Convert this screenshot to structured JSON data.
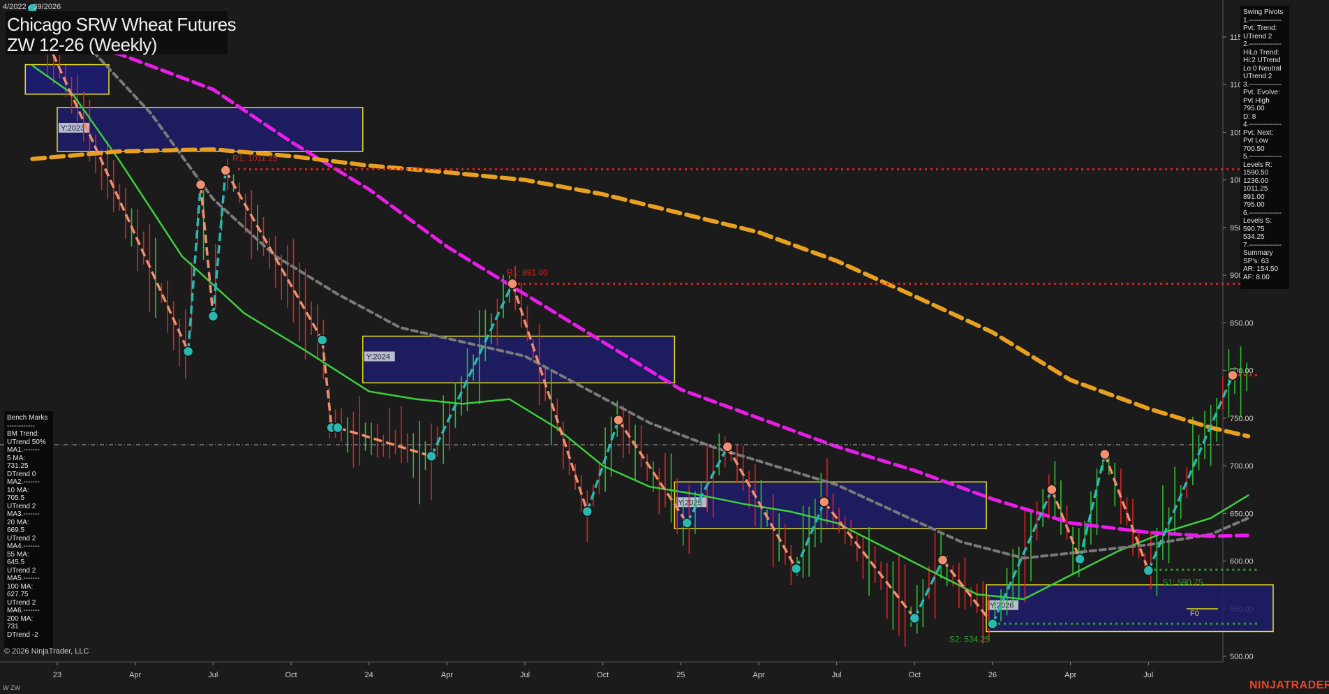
{
  "header": {
    "date_range": "4/2022 - 39/2026",
    "title": "Chicago SRW Wheat Futures",
    "subtitle": "ZW 12-26 (Weekly)"
  },
  "swing_pivots_panel": [
    "Swing Pivots",
    "1.--------------",
    "Pvt. Trend:",
    "UTrend 2",
    "2.--------------",
    "HiLo Trend:",
    "Hi:2 UTrend",
    "Lo:0 Neutral",
    "UTrend 2",
    "3.--------------",
    "Pvt. Evolve:",
    "Pvt High",
    "795.00",
    "D: 8",
    "4.--------------",
    "Pvt. Next:",
    "Pvt Low",
    "700.50",
    "5.--------------",
    "Levels R:",
    "1590.50",
    "1236.00",
    "1011.25",
    "891.00",
    "795.00",
    "6.--------------",
    "Levels S:",
    "590.75",
    "534.25",
    "7.--------------",
    "Summary",
    "SP's: 63",
    "AR: 154.50",
    "AF: 8.00"
  ],
  "bench_marks_panel": [
    "Bench Marks",
    "------------",
    "BM Trend:",
    "UTrend 50%",
    "MA1.-------",
    "5 MA:",
    "731.25",
    "DTrend 0",
    "MA2.-------",
    "10 MA:",
    "705.5",
    "UTrend 2",
    "MA3.-------",
    "20 MA:",
    "669.5",
    "UTrend 2",
    "MA4.-------",
    "55 MA:",
    "645.5",
    "UTrend 2",
    "MA5.-------",
    "100 MA:",
    "627.75",
    "UTrend 2",
    "MA6.-------",
    "200 MA:",
    "731",
    "DTrend -2"
  ],
  "footer": {
    "copyright": "© 2026 NinjaTrader, LLC",
    "symbol": "W ZW",
    "brand": "NINJATRADER"
  },
  "colors": {
    "background": "#1b1b1b",
    "up_bar": "#2fbf2f",
    "down_bar": "#e02020",
    "ma_green": "#3ccf3c",
    "ma_gray": "#7a7a7a",
    "ma_magenta": "#e81ee8",
    "ma_orange": "#e8a020",
    "resistance": "#e02020",
    "support": "#2fa02f",
    "pivot_up": "#2ab8b0",
    "pivot_down": "#f09070",
    "zone_fill": "#1c1c6a",
    "zone_border": "#e8e020"
  },
  "chart_data": {
    "type": "line",
    "title": "Chicago SRW Wheat Futures",
    "subtitle": "ZW 12-26 (Weekly)",
    "ylim": [
      494,
      1180
    ],
    "y_ticks": [
      500,
      550,
      600,
      650,
      700,
      750,
      800,
      850,
      900,
      950,
      1000,
      1050,
      1100,
      1150
    ],
    "y_tick_labels": [
      "500.00",
      "550.00",
      "600.00",
      "650.00",
      "700.00",
      "750.00",
      "800.00",
      "850.00",
      "900.00",
      "950.00",
      "1000.00",
      "1050.00",
      "1100.00",
      "1150.00"
    ],
    "x_tick_labels": [
      "23",
      "Apr",
      "Jul",
      "Oct",
      "24",
      "Apr",
      "Jul",
      "Oct",
      "25",
      "Apr",
      "Jul",
      "Oct",
      "26",
      "Apr",
      "Jul"
    ],
    "x_range": [
      2022.92,
      2026.92
    ],
    "x_ticks": [
      2023.0,
      2023.25,
      2023.5,
      2023.75,
      2024.0,
      2024.25,
      2024.5,
      2024.75,
      2025.0,
      2025.25,
      2025.5,
      2025.75,
      2026.0,
      2026.25,
      2026.5
    ],
    "current_price": 722,
    "series": [
      {
        "name": "5 MA",
        "color": "#3ccf3c",
        "points": [
          [
            2022.92,
            1120
          ],
          [
            2023.05,
            1090
          ],
          [
            2023.2,
            1020
          ],
          [
            2023.4,
            920
          ],
          [
            2023.6,
            860
          ],
          [
            2023.8,
            820
          ],
          [
            2024.0,
            778
          ],
          [
            2024.15,
            770
          ],
          [
            2024.3,
            765
          ],
          [
            2024.45,
            770
          ],
          [
            2024.6,
            740
          ],
          [
            2024.75,
            700
          ],
          [
            2024.9,
            678
          ],
          [
            2025.05,
            670
          ],
          [
            2025.2,
            660
          ],
          [
            2025.35,
            652
          ],
          [
            2025.5,
            640
          ],
          [
            2025.65,
            615
          ],
          [
            2025.8,
            590
          ],
          [
            2025.95,
            565
          ],
          [
            2026.1,
            560
          ],
          [
            2026.25,
            585
          ],
          [
            2026.4,
            610
          ],
          [
            2026.55,
            630
          ],
          [
            2026.7,
            645
          ],
          [
            2026.82,
            669
          ]
        ]
      },
      {
        "name": "10 MA",
        "color": "#7a7a7a",
        "points": [
          [
            2022.92,
            1165
          ],
          [
            2023.1,
            1140
          ],
          [
            2023.3,
            1070
          ],
          [
            2023.5,
            980
          ],
          [
            2023.7,
            920
          ],
          [
            2023.9,
            880
          ],
          [
            2024.1,
            845
          ],
          [
            2024.3,
            830
          ],
          [
            2024.5,
            815
          ],
          [
            2024.7,
            780
          ],
          [
            2024.9,
            745
          ],
          [
            2025.1,
            720
          ],
          [
            2025.3,
            700
          ],
          [
            2025.5,
            680
          ],
          [
            2025.7,
            650
          ],
          [
            2025.9,
            620
          ],
          [
            2026.1,
            603
          ],
          [
            2026.3,
            610
          ],
          [
            2026.5,
            617
          ],
          [
            2026.7,
            628
          ],
          [
            2026.82,
            645
          ]
        ]
      },
      {
        "name": "20 MA",
        "color": "#e81ee8",
        "points": [
          [
            2022.92,
            1150
          ],
          [
            2023.2,
            1132
          ],
          [
            2023.5,
            1095
          ],
          [
            2023.75,
            1040
          ],
          [
            2024.0,
            990
          ],
          [
            2024.25,
            930
          ],
          [
            2024.5,
            880
          ],
          [
            2024.75,
            830
          ],
          [
            2025.0,
            780
          ],
          [
            2025.25,
            750
          ],
          [
            2025.5,
            720
          ],
          [
            2025.75,
            695
          ],
          [
            2026.0,
            665
          ],
          [
            2026.25,
            640
          ],
          [
            2026.5,
            630
          ],
          [
            2026.7,
            626
          ],
          [
            2026.82,
            627
          ]
        ]
      },
      {
        "name": "200 MA",
        "color": "#e8a020",
        "points": [
          [
            2022.92,
            1022
          ],
          [
            2023.2,
            1030
          ],
          [
            2023.5,
            1032
          ],
          [
            2023.75,
            1025
          ],
          [
            2024.0,
            1015
          ],
          [
            2024.25,
            1008
          ],
          [
            2024.5,
            1000
          ],
          [
            2024.75,
            985
          ],
          [
            2025.0,
            965
          ],
          [
            2025.25,
            945
          ],
          [
            2025.5,
            915
          ],
          [
            2025.75,
            878
          ],
          [
            2026.0,
            840
          ],
          [
            2026.25,
            790
          ],
          [
            2026.5,
            760
          ],
          [
            2026.7,
            740
          ],
          [
            2026.82,
            731
          ]
        ]
      }
    ],
    "resistance_levels": [
      {
        "label": "R1: 1011.25",
        "value": 1011.25,
        "from": 2023.58,
        "to": 2026.85
      },
      {
        "label": "R1: 891.00",
        "value": 891.0,
        "from": 2024.46,
        "to": 2026.85
      },
      {
        "label": "",
        "value": 795.0,
        "from": 2026.77,
        "to": 2026.85
      }
    ],
    "support_levels": [
      {
        "label": "S1: 590.75",
        "value": 590.75,
        "from": 2026.5,
        "to": 2026.85
      },
      {
        "label": "S2: 534.25",
        "value": 534.25,
        "from": 2026.0,
        "to": 2026.85
      }
    ],
    "swing_pivots": [
      [
        2022.92,
        1180
      ],
      [
        2023.42,
        820
      ],
      [
        2023.46,
        995
      ],
      [
        2023.5,
        857
      ],
      [
        2023.54,
        1010
      ],
      [
        2023.85,
        832
      ],
      [
        2023.9,
        740
      ],
      [
        2023.88,
        740
      ],
      [
        2024.2,
        710
      ],
      [
        2024.46,
        891
      ],
      [
        2024.7,
        652
      ],
      [
        2024.8,
        748
      ],
      [
        2025.02,
        640
      ],
      [
        2025.15,
        720
      ],
      [
        2025.37,
        592
      ],
      [
        2025.46,
        662
      ],
      [
        2025.75,
        540
      ],
      [
        2025.84,
        601
      ],
      [
        2026.0,
        534
      ],
      [
        2026.19,
        675
      ],
      [
        2026.28,
        602
      ],
      [
        2026.36,
        712
      ],
      [
        2026.5,
        590
      ],
      [
        2026.77,
        795
      ]
    ],
    "year_zones": [
      {
        "label": "Y:2023",
        "x0": 2023.0,
        "x1": 2023.98,
        "y0": 1030,
        "y1": 1076
      },
      {
        "label": "Y:2024",
        "x0": 2023.98,
        "x1": 2024.98,
        "y0": 787,
        "y1": 836
      },
      {
        "label": "Y:2025",
        "x0": 2024.98,
        "x1": 2025.98,
        "y0": 634,
        "y1": 683
      },
      {
        "label": "Y:2026",
        "x0": 2025.98,
        "x1": 2026.9,
        "y0": 526,
        "y1": 575
      }
    ],
    "top_left_zone": {
      "x0": 2022.92,
      "x1": 2023.0,
      "y0": 1090,
      "y1": 1121
    },
    "zone_labels": [
      "Y:2023",
      "Y:2024",
      "Y:2025",
      "Y:2026",
      "F0"
    ],
    "grid": false,
    "y_axis_side": "right"
  }
}
